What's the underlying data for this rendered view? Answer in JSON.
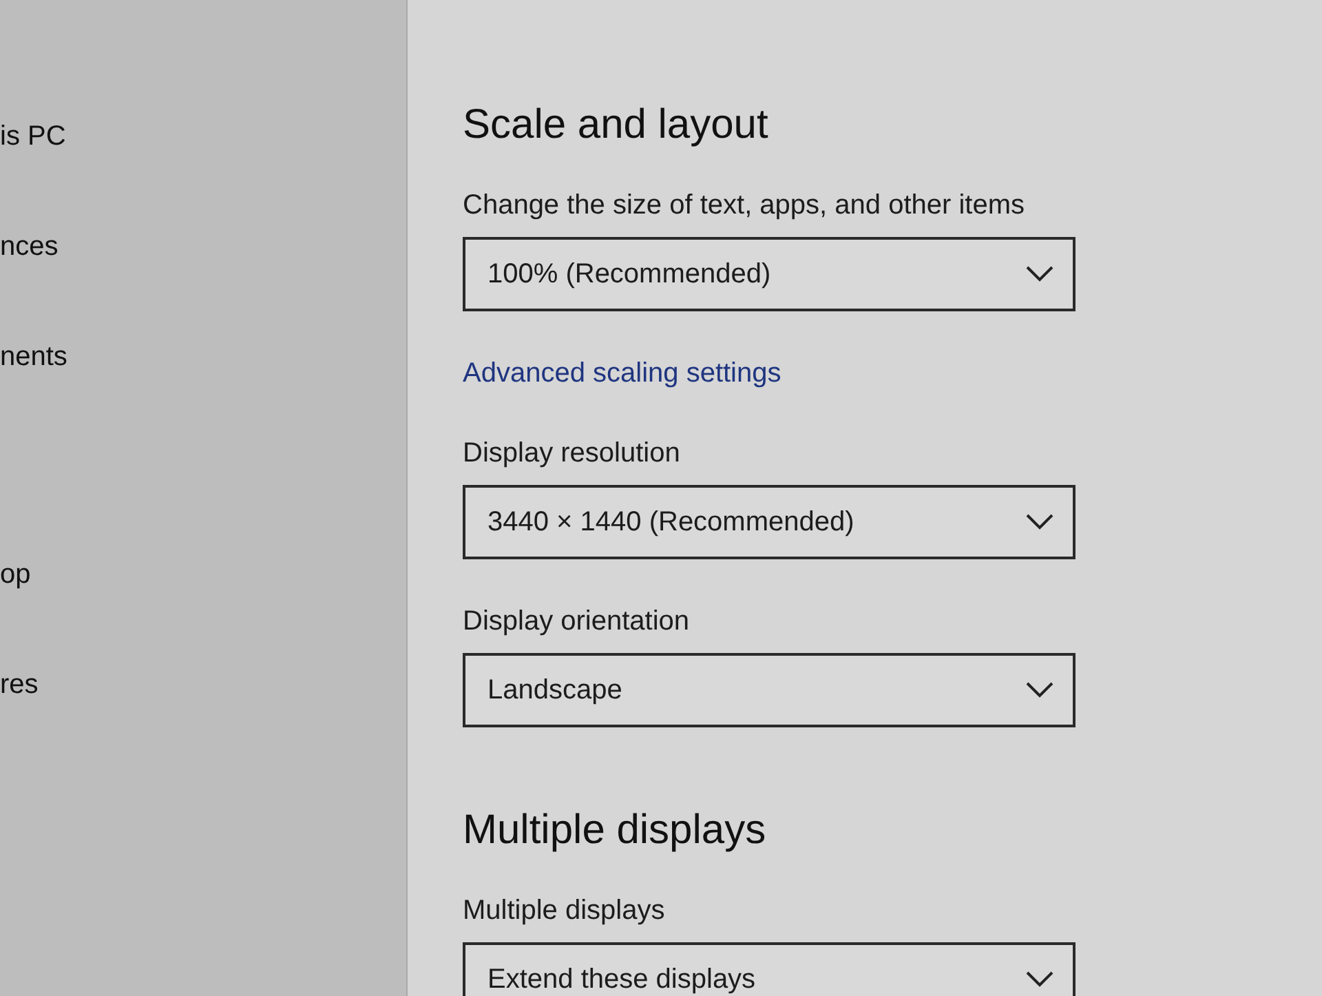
{
  "sidebar": {
    "items": [
      {
        "label": "is PC"
      },
      {
        "label": "nces"
      },
      {
        "label": "nents"
      },
      {
        "label": "op"
      },
      {
        "label": "res"
      }
    ]
  },
  "sections": [
    {
      "heading": "Scale and layout",
      "settings": [
        {
          "kind": "dropdown",
          "label": "Change the size of text, apps, and other items",
          "value": "100% (Recommended)"
        },
        {
          "kind": "link",
          "label": "Advanced scaling settings"
        },
        {
          "kind": "dropdown",
          "label": "Display resolution",
          "value": "3440 × 1440 (Recommended)"
        },
        {
          "kind": "dropdown",
          "label": "Display orientation",
          "value": "Landscape"
        }
      ]
    },
    {
      "heading": "Multiple displays",
      "settings": [
        {
          "kind": "dropdown",
          "label": "Multiple displays",
          "value": "Extend these displays"
        }
      ]
    }
  ]
}
